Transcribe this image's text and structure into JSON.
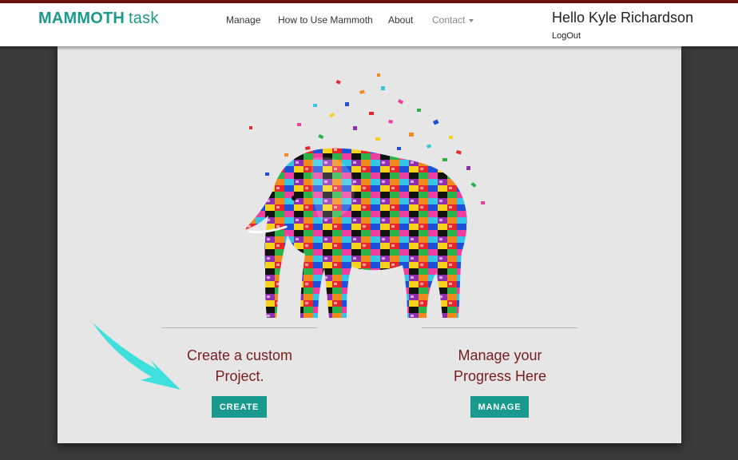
{
  "brand": {
    "bold": "MAMMOTH",
    "light": "task"
  },
  "nav": {
    "items": [
      {
        "label": "Manage"
      },
      {
        "label": "How to Use Mammoth"
      },
      {
        "label": "About"
      },
      {
        "label": "Contact"
      }
    ]
  },
  "user": {
    "greeting": "Hello Kyle Richardson",
    "logout": "LogOut"
  },
  "create": {
    "title_line1": "Create a custom",
    "title_line2": "Project.",
    "button": "CREATE"
  },
  "manage": {
    "title_line1": "Manage your",
    "title_line2": "Progress Here",
    "button": "MANAGE"
  },
  "colors": {
    "brand": "#1a9a8c",
    "heading": "#7a1c1c",
    "arrow": "#3fe0dc",
    "panel": "#e6e6e6",
    "background": "#3a3a3a"
  },
  "icons": {
    "contact_dropdown": "caret-down-icon",
    "pointer": "arrow-icon",
    "hero": "elephant-illustration"
  }
}
